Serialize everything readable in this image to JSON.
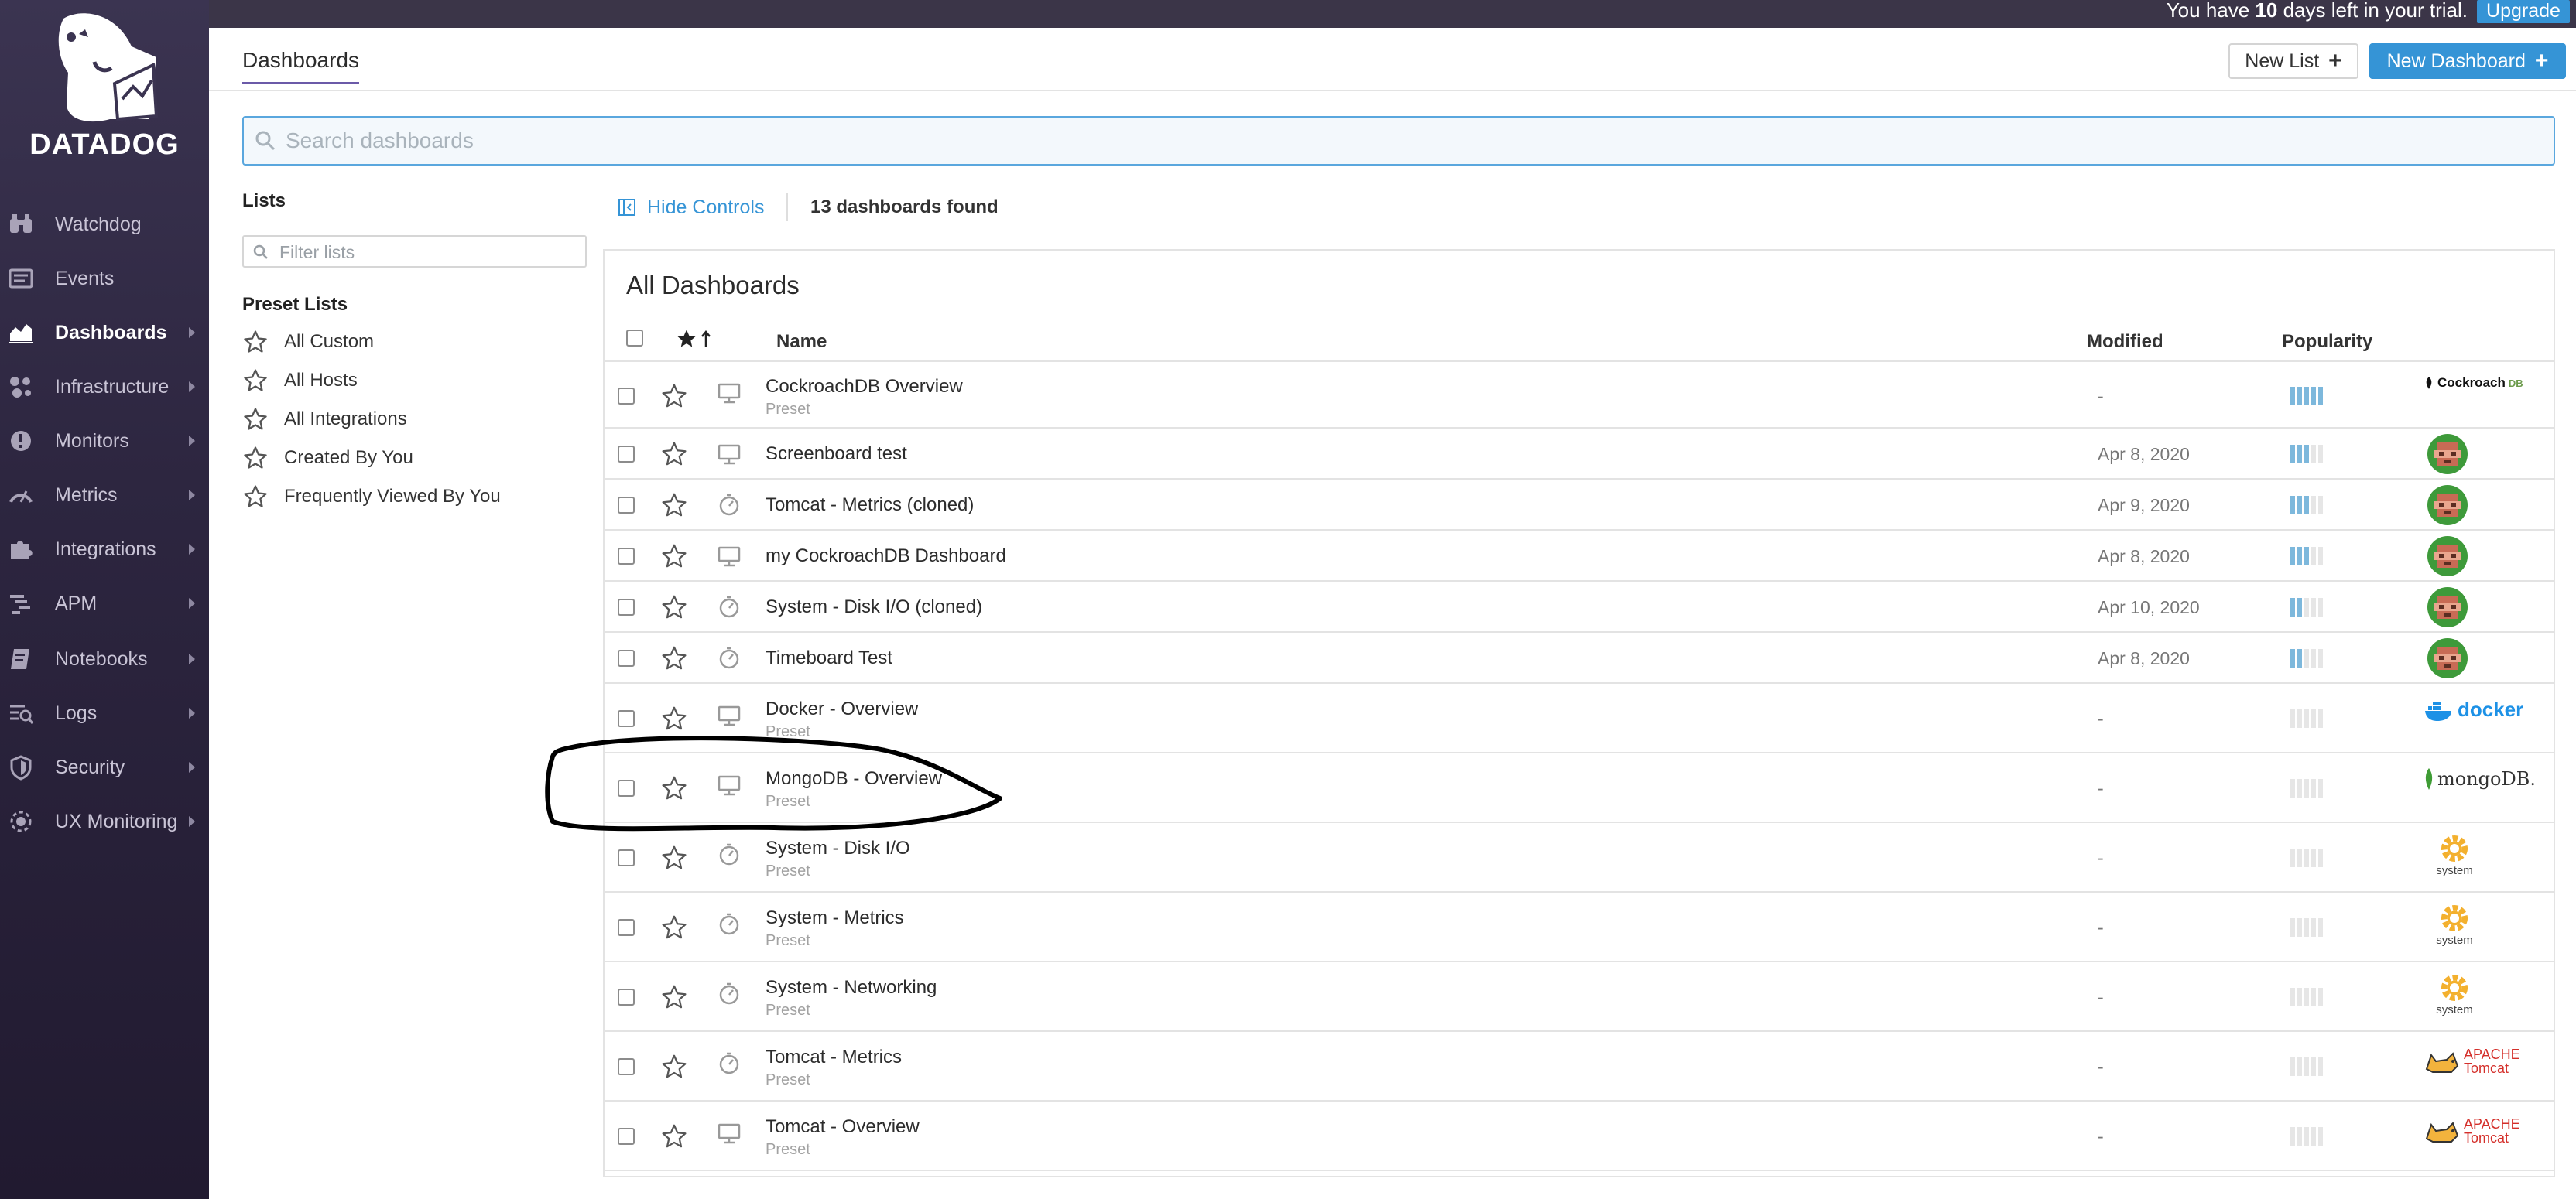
{
  "app": {
    "logo_text": "DATADOG"
  },
  "topbar": {
    "trial_prefix": "You have ",
    "trial_days": "10",
    "trial_suffix": " days left in your trial.",
    "upgrade_label": "Upgrade"
  },
  "sidebar": {
    "items": [
      {
        "label": "Watchdog",
        "icon": "binoculars-icon",
        "has_caret": false,
        "active": false
      },
      {
        "label": "Events",
        "icon": "events-icon",
        "has_caret": false,
        "active": false
      },
      {
        "label": "Dashboards",
        "icon": "dashboards-icon",
        "has_caret": true,
        "active": true
      },
      {
        "label": "Infrastructure",
        "icon": "infrastructure-icon",
        "has_caret": true,
        "active": false
      },
      {
        "label": "Monitors",
        "icon": "monitors-icon",
        "has_caret": true,
        "active": false
      },
      {
        "label": "Metrics",
        "icon": "metrics-icon",
        "has_caret": true,
        "active": false
      },
      {
        "label": "Integrations",
        "icon": "puzzle-icon",
        "has_caret": true,
        "active": false
      },
      {
        "label": "APM",
        "icon": "apm-icon",
        "has_caret": true,
        "active": false
      },
      {
        "label": "Notebooks",
        "icon": "notebook-icon",
        "has_caret": true,
        "active": false
      },
      {
        "label": "Logs",
        "icon": "logs-icon",
        "has_caret": true,
        "active": false
      },
      {
        "label": "Security",
        "icon": "shield-icon",
        "has_caret": true,
        "active": false
      },
      {
        "label": "UX Monitoring",
        "icon": "ux-monitoring-icon",
        "has_caret": true,
        "active": false
      }
    ]
  },
  "header": {
    "title": "Dashboards",
    "new_list_label": "New List",
    "new_dashboard_label": "New Dashboard"
  },
  "search": {
    "placeholder": "Search dashboards",
    "value": ""
  },
  "lists": {
    "title": "Lists",
    "filter_placeholder": "Filter lists",
    "preset_title": "Preset Lists",
    "preset_items": [
      "All Custom",
      "All Hosts",
      "All Integrations",
      "Created By You",
      "Frequently Viewed By You"
    ]
  },
  "controls": {
    "hide_controls_label": "Hide Controls",
    "found_text": "13 dashboards found"
  },
  "table": {
    "title": "All Dashboards",
    "columns": {
      "name": "Name",
      "modified": "Modified",
      "popularity": "Popularity"
    },
    "rows": [
      {
        "name": "CockroachDB Overview",
        "sub": "Preset",
        "type": "screenboard",
        "modified": "-",
        "popularity": 5,
        "owner": "cockroachdb"
      },
      {
        "name": "Screenboard test",
        "sub": "",
        "type": "screenboard",
        "modified": "Apr 8, 2020",
        "popularity": 3,
        "owner": "avatar"
      },
      {
        "name": "Tomcat - Metrics (cloned)",
        "sub": "",
        "type": "timeboard",
        "modified": "Apr 9, 2020",
        "popularity": 3,
        "owner": "avatar"
      },
      {
        "name": "my CockroachDB Dashboard",
        "sub": "",
        "type": "screenboard",
        "modified": "Apr 8, 2020",
        "popularity": 3,
        "owner": "avatar"
      },
      {
        "name": "System - Disk I/O (cloned)",
        "sub": "",
        "type": "timeboard",
        "modified": "Apr 10, 2020",
        "popularity": 2,
        "owner": "avatar"
      },
      {
        "name": "Timeboard Test",
        "sub": "",
        "type": "timeboard",
        "modified": "Apr 8, 2020",
        "popularity": 2,
        "owner": "avatar"
      },
      {
        "name": "Docker - Overview",
        "sub": "Preset",
        "type": "screenboard",
        "modified": "-",
        "popularity": 0,
        "owner": "docker"
      },
      {
        "name": "MongoDB - Overview",
        "sub": "Preset",
        "type": "screenboard",
        "modified": "-",
        "popularity": 0,
        "owner": "mongodb"
      },
      {
        "name": "System - Disk I/O",
        "sub": "Preset",
        "type": "timeboard",
        "modified": "-",
        "popularity": 0,
        "owner": "system"
      },
      {
        "name": "System - Metrics",
        "sub": "Preset",
        "type": "timeboard",
        "modified": "-",
        "popularity": 0,
        "owner": "system"
      },
      {
        "name": "System - Networking",
        "sub": "Preset",
        "type": "timeboard",
        "modified": "-",
        "popularity": 0,
        "owner": "system"
      },
      {
        "name": "Tomcat - Metrics",
        "sub": "Preset",
        "type": "timeboard",
        "modified": "-",
        "popularity": 0,
        "owner": "tomcat"
      },
      {
        "name": "Tomcat - Overview",
        "sub": "Preset",
        "type": "screenboard",
        "modified": "-",
        "popularity": 0,
        "owner": "tomcat"
      }
    ]
  },
  "owner_logos": {
    "cockroachdb": "Cockroach",
    "cockroachdb_suffix": "DB",
    "docker": "docker",
    "mongodb": "mongoDB.",
    "system": "system",
    "tomcat_top": "APACHE",
    "tomcat_bottom": "Tomcat"
  },
  "colors": {
    "accent": "#3594d6",
    "sidebar": "#2d2640",
    "popularity_on": "#7db8dc",
    "avatar_green": "#3e9a3a",
    "system_orange": "#f3b02e",
    "tomcat_red": "#d42f2a"
  }
}
